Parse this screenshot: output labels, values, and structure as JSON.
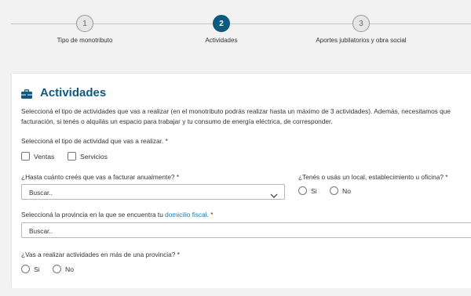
{
  "stepper": {
    "steps": [
      {
        "number": "1",
        "label": "Tipo de monotributo",
        "state": "pending"
      },
      {
        "number": "2",
        "label": "Actividades",
        "state": "active"
      },
      {
        "number": "3",
        "label": "Aportes jubilatorios y obra social",
        "state": "pending"
      }
    ]
  },
  "section": {
    "icon": "briefcase-icon",
    "title": "Actividades",
    "description": "Seleccioná el tipo de actividades que vas a realizar (en el monotributo podrás realizar hasta un máximo de 3 actividades). Además, necesitamos que facturación, si tenés o alquilás un espacio para trabajar y tu consumo de energía eléctrica, de corresponder."
  },
  "activity_type": {
    "label": "Seleccioná el tipo de actividad que vas a realizar. *",
    "options": [
      "Ventas",
      "Servicios"
    ]
  },
  "billing": {
    "label": "¿Hasta cuánto creés que vas a facturar anualmente? *",
    "value": "Buscar.."
  },
  "premises": {
    "label": "¿Tenés o usás un local, establecimiento u oficina? *",
    "options": [
      "Si",
      "No"
    ]
  },
  "province": {
    "label_prefix": "Seleccioná la provincia en la que se encuentra tu ",
    "label_link": "domicilio fiscal",
    "label_suffix": ". *",
    "value": "Buscar.."
  },
  "multi_province": {
    "label": "¿Vas a realizar actividades en más de una provincia? *",
    "options": [
      "Si",
      "No"
    ]
  },
  "colors": {
    "accent": "#0e5a7e",
    "link": "#0e7ab3",
    "background": "#f2f2f2"
  }
}
